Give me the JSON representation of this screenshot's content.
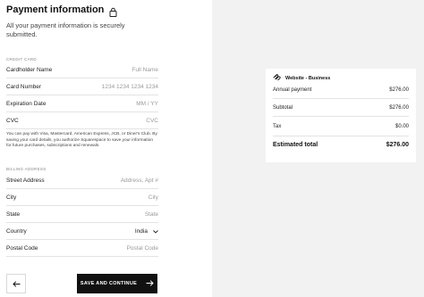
{
  "page": {
    "title": "Payment information",
    "subtitle": "All your payment information is securely submitted."
  },
  "credit_card": {
    "section_label": "CREDIT CARD",
    "fields": [
      {
        "label": "Cardholder Name",
        "placeholder": "Full Name"
      },
      {
        "label": "Card Number",
        "placeholder": "1234 1234 1234 1234"
      },
      {
        "label": "Expiration Date",
        "placeholder": "MM / YY"
      },
      {
        "label": "CVC",
        "placeholder": "CVC"
      }
    ],
    "note": "You can pay with Visa, Mastercard, American Express, JCB, or Diner's Club. By saving your card details, you authorize Squarespace to save your information for future purchases, subscriptions and renewals."
  },
  "billing_address": {
    "section_label": "BILLING ADDRESS",
    "street": {
      "label": "Street Address",
      "placeholder": "Address, Apt #"
    },
    "city": {
      "label": "City",
      "placeholder": "City"
    },
    "state": {
      "label": "State",
      "placeholder": "State"
    },
    "country": {
      "label": "Country",
      "value": "India"
    },
    "postal": {
      "label": "Postal Code",
      "placeholder": "Postal Code"
    }
  },
  "actions": {
    "save_label": "SAVE AND CONTINUE",
    "back_icon": "arrow-left-icon",
    "save_icon": "arrow-right-icon"
  },
  "summary": {
    "plan": "Website - Business",
    "plan_icon": "squarespace-logo-icon",
    "annual_label": "Annual payment",
    "annual_value": "$276.00",
    "subtotal_label": "Subtotal",
    "subtotal_value": "$276.00",
    "tax_label": "Tax",
    "tax_value": "$0.00",
    "total_label": "Estimated total",
    "total_value": "$276.00"
  }
}
